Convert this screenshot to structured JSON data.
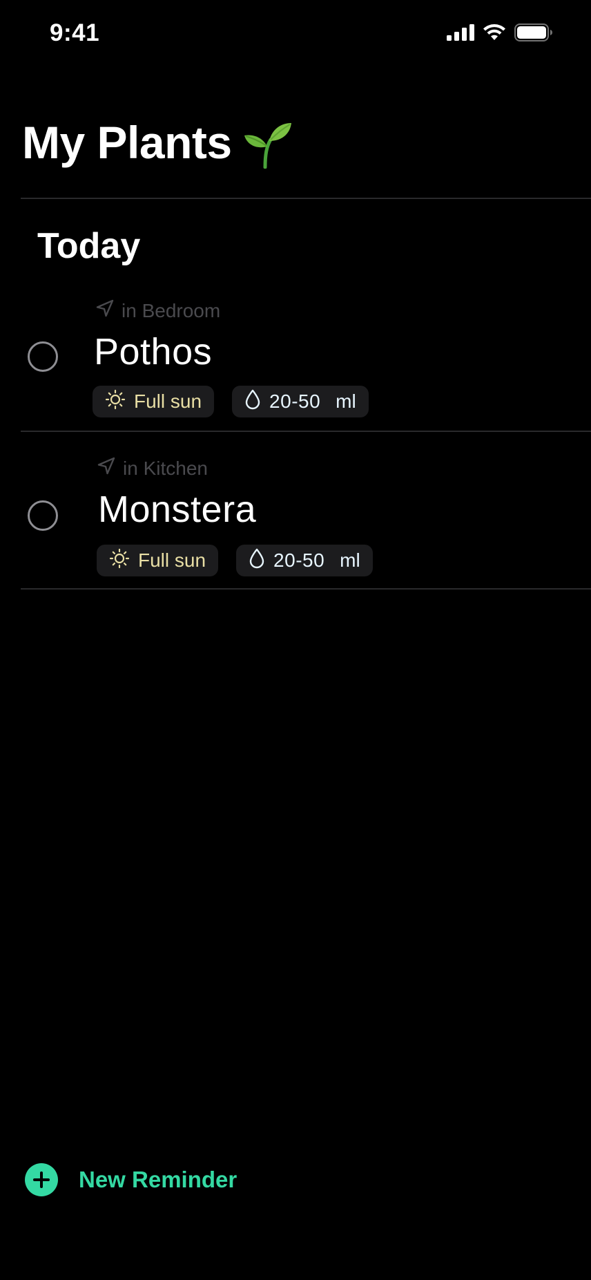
{
  "status_bar": {
    "time": "9:41",
    "icons": [
      "cellular-signal-icon",
      "wifi-icon",
      "battery-icon"
    ]
  },
  "header": {
    "title": "My Plants",
    "emoji_icon": "sprout-icon"
  },
  "section": {
    "title": "Today"
  },
  "reminders": [
    {
      "location": "in Bedroom",
      "name": "Pothos",
      "light": "Full sun",
      "water_amount": "20-50",
      "water_unit": "ml"
    },
    {
      "location": "in Kitchen",
      "name": "Monstera",
      "light": "Full sun",
      "water_amount": "20-50",
      "water_unit": "ml"
    }
  ],
  "footer": {
    "new_reminder_label": "New Reminder"
  },
  "colors": {
    "background": "#000000",
    "accent": "#34d9a3",
    "sun_chip_text": "#e9dfa5",
    "water_chip_text": "#e8f6ff",
    "chip_background": "#1c1c1e",
    "muted_text": "#4a4a4e"
  }
}
